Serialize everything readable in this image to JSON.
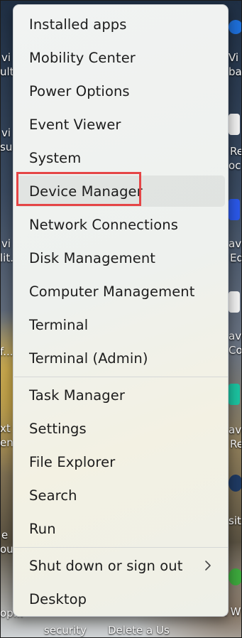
{
  "menu": {
    "groups": [
      [
        "Installed apps",
        "Mobility Center",
        "Power Options",
        "Event Viewer",
        "System",
        "Device Manager",
        "Network Connections",
        "Disk Management",
        "Computer Management",
        "Terminal",
        "Terminal (Admin)"
      ],
      [
        "Task Manager",
        "Settings",
        "File Explorer",
        "Search",
        "Run"
      ],
      [
        "Shut down or sign out",
        "Desktop"
      ]
    ],
    "highlighted_item": "Device Manager",
    "submenu_indicator": "chevron-right-icon"
  },
  "desktop": {
    "left_labels": [
      "vi",
      "ult.",
      "vi",
      "sui",
      "vi",
      "lit.",
      "f...",
      "xt",
      "ent",
      "e",
      "out",
      "op..."
    ],
    "right_labels": [
      "Vi",
      "bac",
      "Re",
      "oc",
      "avi",
      "Ed",
      "avi",
      "Co",
      "avi",
      "Re",
      "sit",
      "t W"
    ],
    "bottom_labels": [
      "security",
      "Delete a Us"
    ]
  },
  "colors": {
    "highlight_border": "#e54546",
    "menu_background": "#eef1ee",
    "menu_text": "#1c1c1c"
  }
}
